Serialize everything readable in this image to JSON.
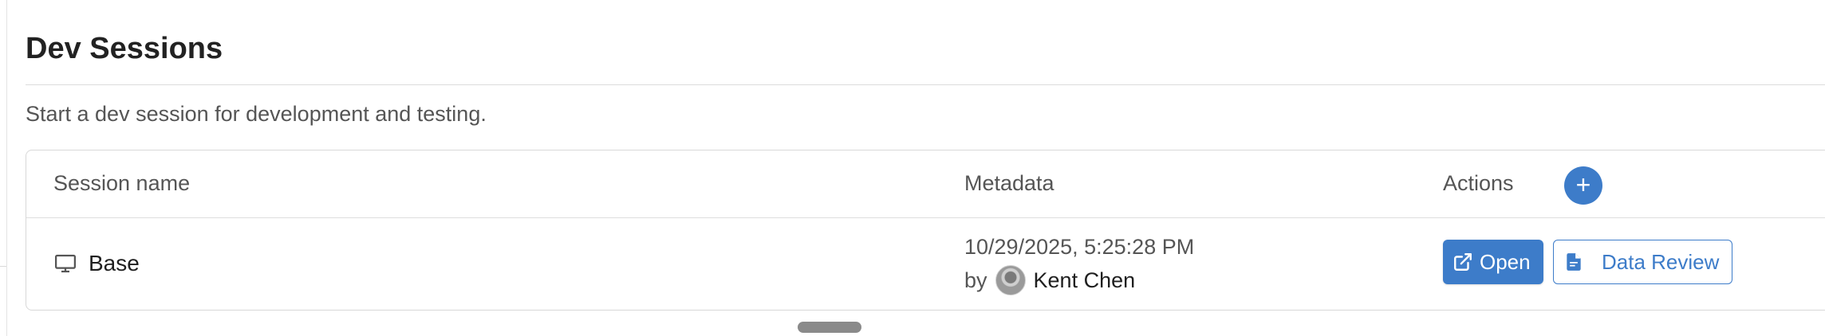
{
  "section": {
    "title": "Dev Sessions",
    "subtitle": "Start a dev session for development and testing."
  },
  "table": {
    "headers": {
      "name": "Session name",
      "metadata": "Metadata",
      "actions": "Actions"
    },
    "add_button_label": "+",
    "rows": [
      {
        "icon": "monitor-icon",
        "name": "Base",
        "timestamp": "10/29/2025, 5:25:28 PM",
        "by_label": "by",
        "author": "Kent Chen",
        "open_label": "Open",
        "review_label": "Data Review"
      }
    ]
  },
  "colors": {
    "accent": "#3d7cc9",
    "border": "#d8d8d8",
    "muted_text": "#555555"
  }
}
